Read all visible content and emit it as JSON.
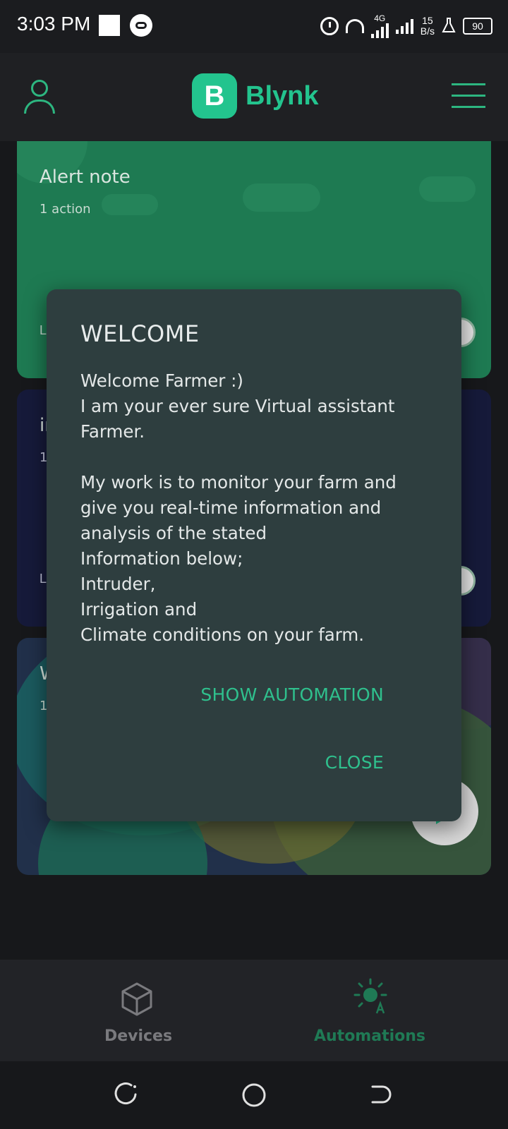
{
  "status_bar": {
    "time": "3:03 PM",
    "network": "4G",
    "speed_value": "15",
    "speed_unit": "B/s",
    "battery": "90"
  },
  "header": {
    "logo_letter": "B",
    "app_name": "Blynk"
  },
  "cards": [
    {
      "title": "Alert note",
      "subtitle": "1 action",
      "footer": "L"
    },
    {
      "title": "in",
      "subtitle": "1",
      "footer": "L"
    },
    {
      "title": "W",
      "subtitle": "1",
      "footer": ""
    }
  ],
  "dialog": {
    "title": "WELCOME",
    "lines": [
      "Welcome Farmer  :)",
      "I am your ever sure Virtual assistant Farmer.",
      "My work is to monitor your farm and give you real-time information and analysis of the stated",
      "Information below;",
      "Intruder,",
      "Irrigation and",
      "Climate conditions on your farm."
    ],
    "show_automation_label": "SHOW AUTOMATION",
    "close_label": "CLOSE"
  },
  "bottom_nav": {
    "devices_label": "Devices",
    "automations_label": "Automations",
    "active": "Automations"
  },
  "colors": {
    "accent": "#23c48e",
    "dialog_bg": "#2e3e3f",
    "card_alert": "#1e7a52"
  }
}
